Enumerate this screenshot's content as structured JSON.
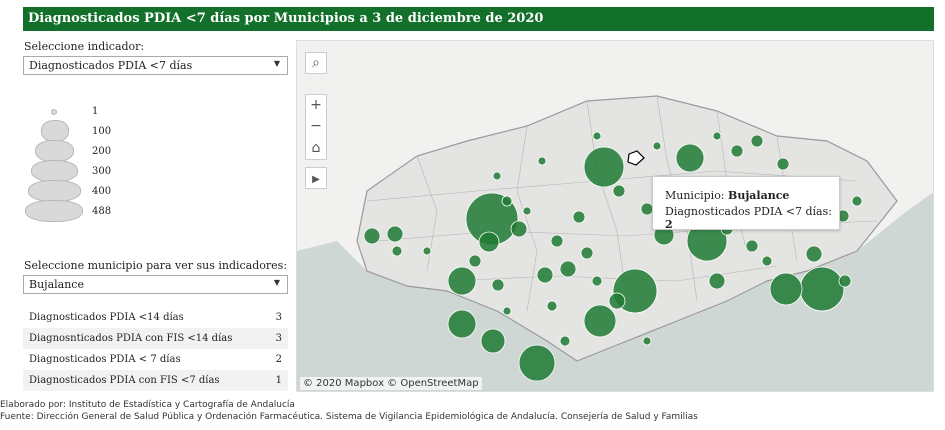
{
  "title": "Diagnosticados PDIA <7 días por Municipios a 3 de diciembre de 2020",
  "indicator_selector": {
    "label": "Seleccione indicador:",
    "value": "Diagnosticados PDIA <7 días"
  },
  "size_legend": [
    "1",
    "100",
    "200",
    "300",
    "400",
    "488"
  ],
  "municipality_selector": {
    "label": "Seleccione municipio para ver sus indicadores:",
    "value": "Bujalance"
  },
  "indicators": [
    {
      "name": "Diagnosticados PDIA <14 días",
      "value": "3"
    },
    {
      "name": "Diagnosnticados PDIA con FIS <14 días",
      "value": "3"
    },
    {
      "name": "Diagnosticados PDIA < 7 días",
      "value": "2"
    },
    {
      "name": "Diagnosticados PDIA con FIS <7 días",
      "value": "1"
    }
  ],
  "map": {
    "controls": [
      "search-icon",
      "zoom-in-icon",
      "zoom-out-icon",
      "home-icon",
      "play-icon"
    ],
    "attribution": "© 2020 Mapbox  © OpenStreetMap",
    "tooltip": {
      "municipio_label": "Municipio:",
      "municipio_value": "Bujalance",
      "indicator_label": "Diagnosticados PDIA <7 días:",
      "indicator_value": "2"
    },
    "colors": {
      "circle": "#1e7a32",
      "sea": "#cfd7d5",
      "land": "#f1f1ef"
    }
  },
  "footer": {
    "line1": "Elaborado por: Instituto de Estadística y Cartografía de Andalucía",
    "line2": "Fuente: Dirección General de Salud Pública y Ordenación Farmacéutica. Sistema de Vigilancia Epidemiológica de Andalucía. Consejería de Salud y Familias"
  }
}
